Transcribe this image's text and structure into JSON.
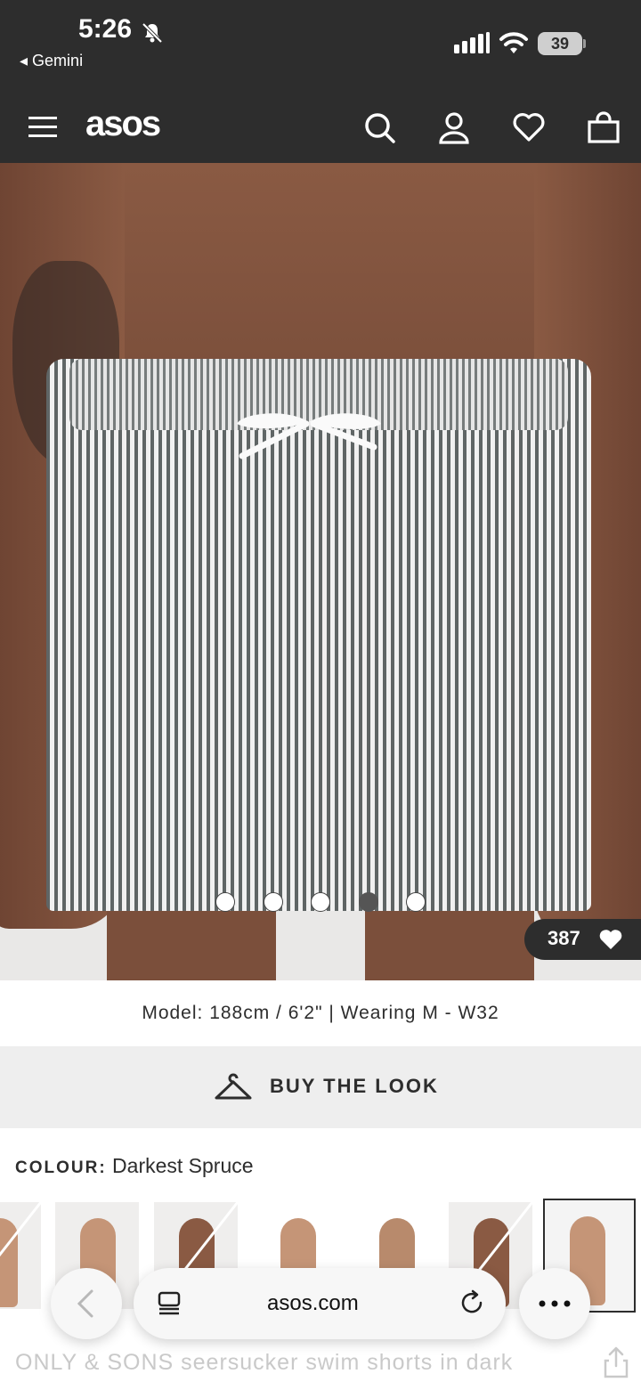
{
  "status_bar": {
    "time": "5:26",
    "back_app": "Gemini",
    "battery": "39"
  },
  "header": {
    "logo": "asos",
    "icons": [
      "menu-icon",
      "search-icon",
      "account-icon",
      "heart-icon",
      "bag-icon"
    ]
  },
  "gallery": {
    "image_count": 5,
    "active_index": 3,
    "likes": "387"
  },
  "model_info": "Model: 188cm / 6'2\" | Wearing M - W32",
  "buy_the_look": "BUY THE LOOK",
  "colour": {
    "label": "COLOUR:",
    "value": "Darkest Spruce"
  },
  "browser": {
    "url": "asos.com"
  },
  "product_title": "ONLY & SONS seersucker swim shorts in dark",
  "colors": {
    "header_bg": "#2d2d2d",
    "buy_look_bg": "#eeeeee"
  }
}
